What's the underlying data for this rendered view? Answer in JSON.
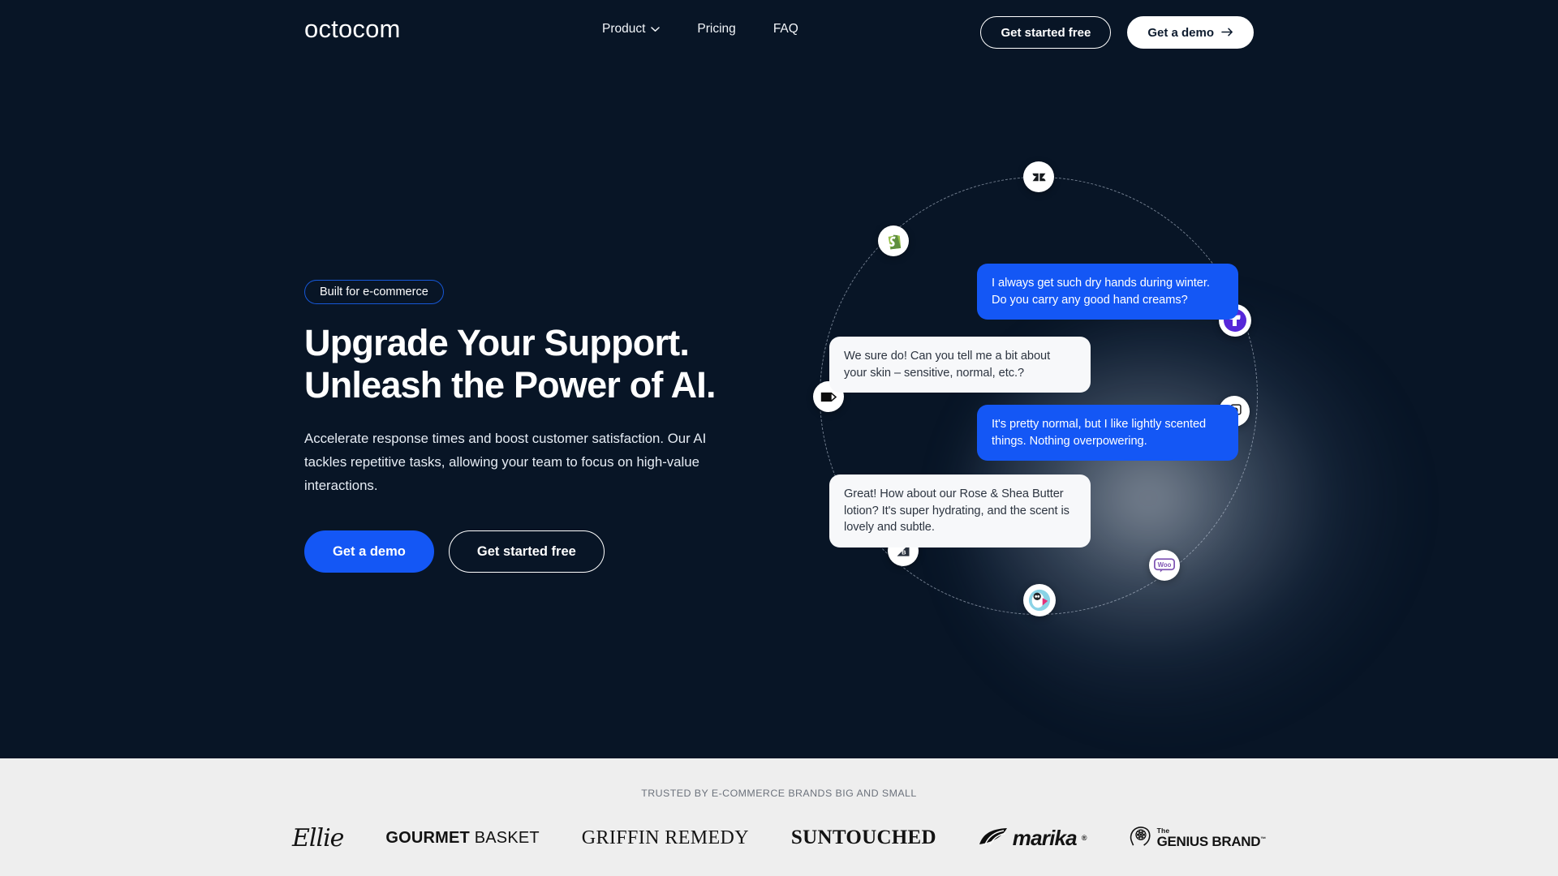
{
  "brand": {
    "logo_text": "octocom"
  },
  "colors": {
    "background": "#081526",
    "accent_blue": "#1457f5",
    "pill_border": "#1657d6",
    "trusted_bg": "#eeeeee",
    "bot_bubble": "#f7f8fa"
  },
  "header": {
    "nav": [
      {
        "label": "Product",
        "icon": "chevron-down-icon",
        "has_dropdown": true
      },
      {
        "label": "Pricing",
        "has_dropdown": false
      },
      {
        "label": "FAQ",
        "has_dropdown": false
      }
    ],
    "actions": {
      "secondary_label": "Get started free",
      "primary_label": "Get a demo",
      "primary_icon": "arrow-right-icon"
    }
  },
  "hero": {
    "badge": "Built for e-commerce",
    "title_line1": "Upgrade Your Support.",
    "title_line2": "Unleash the Power of AI.",
    "subtitle": "Accelerate response times and boost customer satisfaction. Our AI tackles repetitive tasks, allowing your team to focus on high-value interactions.",
    "cta_primary": "Get a demo",
    "cta_secondary": "Get started free"
  },
  "chat": {
    "messages": [
      {
        "from": "user",
        "text": "I always get such dry hands during winter. Do you carry any good hand creams?"
      },
      {
        "from": "bot",
        "text": "We sure do! Can you tell me a bit about your skin – sensitive, normal, etc.?"
      },
      {
        "from": "user",
        "text": "It's pretty normal, but I like lightly scented things. Nothing overpowering."
      },
      {
        "from": "bot",
        "text": "Great! How about our Rose & Shea Butter lotion? It's super hydrating, and the scent is lovely and subtle."
      }
    ]
  },
  "orbit": {
    "integrations": [
      {
        "name": "zendesk-icon",
        "label": "Zendesk"
      },
      {
        "name": "shopify-icon",
        "label": "Shopify"
      },
      {
        "name": "klaviyo-icon",
        "label": "Klaviyo"
      },
      {
        "name": "bigcommerce-icon",
        "label": "BigCommerce"
      },
      {
        "name": "prestashop-icon",
        "label": "PrestaShop"
      },
      {
        "name": "woocommerce-icon",
        "label": "WooCommerce"
      },
      {
        "name": "magento-icon",
        "label": "Magento"
      },
      {
        "name": "gorgias-icon",
        "label": "Gorgias"
      }
    ]
  },
  "trusted": {
    "label": "TRUSTED BY E-COMMERCE BRANDS BIG AND SMALL",
    "brands": [
      {
        "name": "ellie",
        "text": "Ellie"
      },
      {
        "name": "gourmet-basket",
        "bold": "GOURMET",
        "light": "BASKET"
      },
      {
        "name": "griffin-remedy",
        "text": "GRIFFIN REMEDY"
      },
      {
        "name": "suntouched",
        "text": "SUNTOUCHED"
      },
      {
        "name": "marika",
        "text": "marika",
        "mark": "®"
      },
      {
        "name": "the-genius-brand",
        "the": "The",
        "main": "GENIUS BRAND",
        "mark": "™"
      }
    ]
  }
}
